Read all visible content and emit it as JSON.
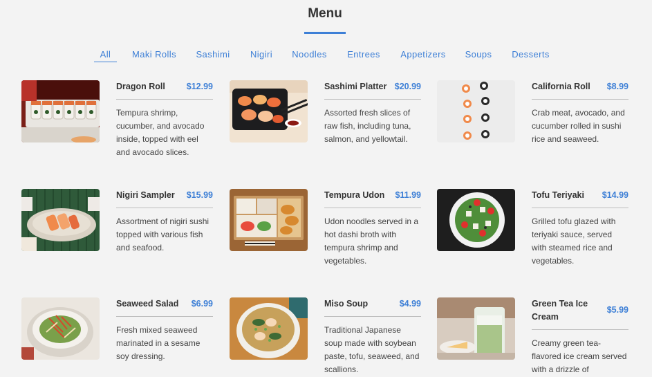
{
  "header": {
    "title": "Menu"
  },
  "tabs": [
    "All",
    "Maki Rolls",
    "Sashimi",
    "Nigiri",
    "Noodles",
    "Entrees",
    "Appetizers",
    "Soups",
    "Desserts"
  ],
  "items": [
    {
      "name": "Dragon Roll",
      "price": "$12.99",
      "description": "Tempura shrimp, cucumber, and avocado inside, topped with eel and avocado slices.",
      "image_icon": "sushi-roll-photo"
    },
    {
      "name": "Sashimi Platter",
      "price": "$20.99",
      "description": "Assorted fresh slices of raw fish, including tuna, salmon, and yellowtail.",
      "image_icon": "sashimi-tray-photo"
    },
    {
      "name": "California Roll",
      "price": "$8.99",
      "description": "Crab meat, avocado, and cucumber rolled in sushi rice and seaweed.",
      "image_icon": "maki-pieces-photo"
    },
    {
      "name": "Nigiri Sampler",
      "price": "$15.99",
      "description": "Assortment of nigiri sushi topped with various fish and seafood.",
      "image_icon": "nigiri-plate-photo"
    },
    {
      "name": "Tempura Udon",
      "price": "$11.99",
      "description": "Udon noodles served in a hot dashi broth with tempura shrimp and vegetables.",
      "image_icon": "bento-box-photo"
    },
    {
      "name": "Tofu Teriyaki",
      "price": "$14.99",
      "description": "Grilled tofu glazed with teriyaki sauce, served with steamed rice and vegetables.",
      "image_icon": "salad-plate-photo"
    },
    {
      "name": "Seaweed Salad",
      "price": "$6.99",
      "description": "Fresh mixed seaweed marinated in a sesame soy dressing.",
      "image_icon": "seaweed-bowl-photo"
    },
    {
      "name": "Miso Soup",
      "price": "$4.99",
      "description": "Traditional Japanese soup made with soybean paste, tofu, seaweed, and scallions.",
      "image_icon": "soup-bowl-photo"
    },
    {
      "name": "Green Tea Ice Cream",
      "price": "$5.99",
      "description": "Creamy green tea-flavored ice cream served with a drizzle of",
      "image_icon": "matcha-drink-photo"
    }
  ],
  "colors": {
    "accent": "#3d7fd6",
    "background": "#f3f3f3",
    "text": "#333333"
  }
}
